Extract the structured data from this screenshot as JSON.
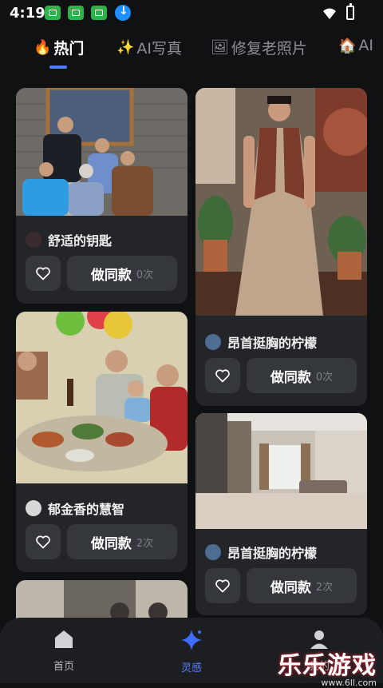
{
  "status_bar": {
    "time": "4:19"
  },
  "tabs": [
    {
      "icon": "🔥",
      "label": "热门",
      "active": true
    },
    {
      "icon": "✨",
      "label": "AI写真",
      "active": false
    },
    {
      "icon": "🖼",
      "label": "修复老照片",
      "active": false
    },
    {
      "icon": "🏠",
      "label": "AI",
      "active": false
    }
  ],
  "cards": [
    {
      "title": "舒适的钥匙",
      "same_label": "做同款",
      "count": "0次"
    },
    {
      "title": "昂首挺胸的柠檬",
      "same_label": "做同款",
      "count": "0次"
    },
    {
      "title": "郁金香的慧智",
      "same_label": "做同款",
      "count": "2次"
    },
    {
      "title": "昂首挺胸的柠檬",
      "same_label": "做同款",
      "count": "2次"
    }
  ],
  "bottom_nav": [
    {
      "label": "首页",
      "icon": "home-icon"
    },
    {
      "label": "灵感",
      "icon": "sparkle-icon",
      "active": true
    },
    {
      "label": "我的",
      "icon": "profile-icon"
    }
  ],
  "watermark": {
    "title": "乐乐游戏",
    "url": "www.6ll.com"
  },
  "colors": {
    "accent": "#4d7cfe",
    "background": "#0f1113",
    "card": "#232529"
  }
}
